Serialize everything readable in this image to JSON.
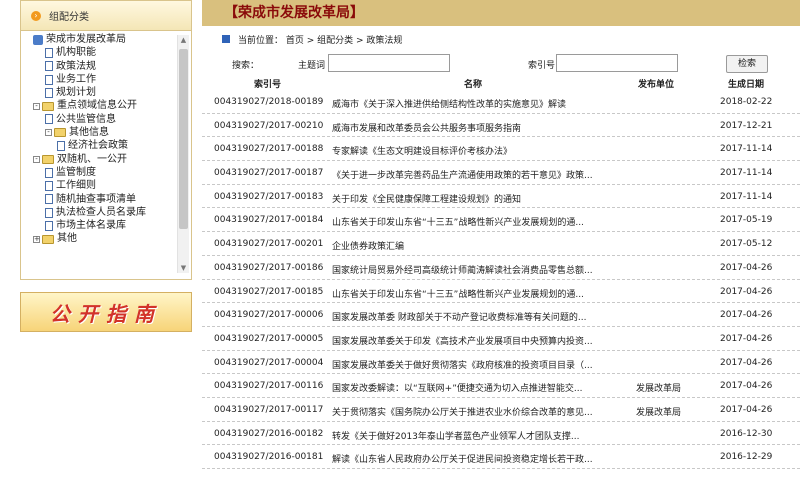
{
  "sidebar": {
    "title": "组配分类",
    "tree": [
      {
        "label": "荣成市发展改革局",
        "type": "root",
        "toggle": ""
      },
      {
        "label": "机构职能",
        "type": "doc",
        "toggle": ""
      },
      {
        "label": "政策法规",
        "type": "doc",
        "toggle": ""
      },
      {
        "label": "业务工作",
        "type": "doc",
        "toggle": ""
      },
      {
        "label": "规划计划",
        "type": "doc",
        "toggle": ""
      },
      {
        "label": "重点领域信息公开",
        "type": "folder",
        "toggle": "-"
      },
      {
        "label": "公共监管信息",
        "type": "doc",
        "toggle": ""
      },
      {
        "label": "其他信息",
        "type": "folder",
        "toggle": "-"
      },
      {
        "label": "经济社会政策",
        "type": "doc",
        "toggle": ""
      },
      {
        "label": "双随机、一公开",
        "type": "folder",
        "toggle": "-"
      },
      {
        "label": "监管制度",
        "type": "doc",
        "toggle": ""
      },
      {
        "label": "工作细则",
        "type": "doc",
        "toggle": ""
      },
      {
        "label": "随机抽查事项清单",
        "type": "doc",
        "toggle": ""
      },
      {
        "label": "执法检查人员名录库",
        "type": "doc",
        "toggle": ""
      },
      {
        "label": "市场主体名录库",
        "type": "doc",
        "toggle": ""
      },
      {
        "label": "其他",
        "type": "folder",
        "toggle": "+"
      }
    ],
    "guide_banner": "公开指南"
  },
  "header": {
    "site_title": "【荣成市发展改革局】"
  },
  "breadcrumb": {
    "text": "当前位置： 首页 > 组配分类 > 政策法规"
  },
  "search": {
    "label": "搜索：",
    "topic_label": "主题词",
    "topic_value": "",
    "index_label": "索引号",
    "index_value": "",
    "button": "检索"
  },
  "table": {
    "columns": [
      "索引号",
      "名称",
      "发布单位",
      "生成日期"
    ],
    "rows": [
      {
        "idx": "004319027/2018-00189",
        "name": "威海市《关于深入推进供给侧结构性改革的实施意见》解读",
        "unit": "",
        "date": "2018-02-22"
      },
      {
        "idx": "004319027/2017-00210",
        "name": "威海市发展和改革委员会公共服务事项服务指南",
        "unit": "",
        "date": "2017-12-21"
      },
      {
        "idx": "004319027/2017-00188",
        "name": "专家解读《生态文明建设目标评价考核办法》",
        "unit": "",
        "date": "2017-11-14"
      },
      {
        "idx": "004319027/2017-00187",
        "name": "《关于进一步改革完善药品生产流通使用政策的若干意见》政策...",
        "unit": "",
        "date": "2017-11-14"
      },
      {
        "idx": "004319027/2017-00183",
        "name": "关于印发《全民健康保障工程建设规划》的通知",
        "unit": "",
        "date": "2017-11-14"
      },
      {
        "idx": "004319027/2017-00184",
        "name": "山东省关于印发山东省“十三五”战略性新兴产业发展规划的通...",
        "unit": "",
        "date": "2017-05-19"
      },
      {
        "idx": "004319027/2017-00201",
        "name": "企业债券政策汇编",
        "unit": "",
        "date": "2017-05-12"
      },
      {
        "idx": "004319027/2017-00186",
        "name": "国家统计局贸易外经司高级统计师蔺涛解读社会消费品零售总额...",
        "unit": "",
        "date": "2017-04-26"
      },
      {
        "idx": "004319027/2017-00185",
        "name": "山东省关于印发山东省“十三五”战略性新兴产业发展规划的通...",
        "unit": "",
        "date": "2017-04-26"
      },
      {
        "idx": "004319027/2017-00006",
        "name": "国家发展改革委 财政部关于不动产登记收费标准等有关问题的...",
        "unit": "",
        "date": "2017-04-26"
      },
      {
        "idx": "004319027/2017-00005",
        "name": "国家发展改革委关于印发《高技术产业发展项目中央预算内投资...",
        "unit": "",
        "date": "2017-04-26"
      },
      {
        "idx": "004319027/2017-00004",
        "name": "国家发展改革委关于做好贯彻落实《政府核准的投资项目目录（...",
        "unit": "",
        "date": "2017-04-26"
      },
      {
        "idx": "004319027/2017-00116",
        "name": "国家发改委解读：以“互联网+”便捷交通为切入点推进智能交...",
        "unit": "发展改革局",
        "date": "2017-04-26"
      },
      {
        "idx": "004319027/2017-00117",
        "name": "关于贯彻落实《国务院办公厅关于推进农业水价综合改革的意见...",
        "unit": "发展改革局",
        "date": "2017-04-26"
      },
      {
        "idx": "004319027/2016-00182",
        "name": "转发《关于做好2013年泰山学者蓝色产业领军人才团队支撑...",
        "unit": "",
        "date": "2016-12-30"
      },
      {
        "idx": "004319027/2016-00181",
        "name": "解读《山东省人民政府办公厅关于促进民间投资稳定增长若干政...",
        "unit": "",
        "date": "2016-12-29"
      }
    ]
  }
}
